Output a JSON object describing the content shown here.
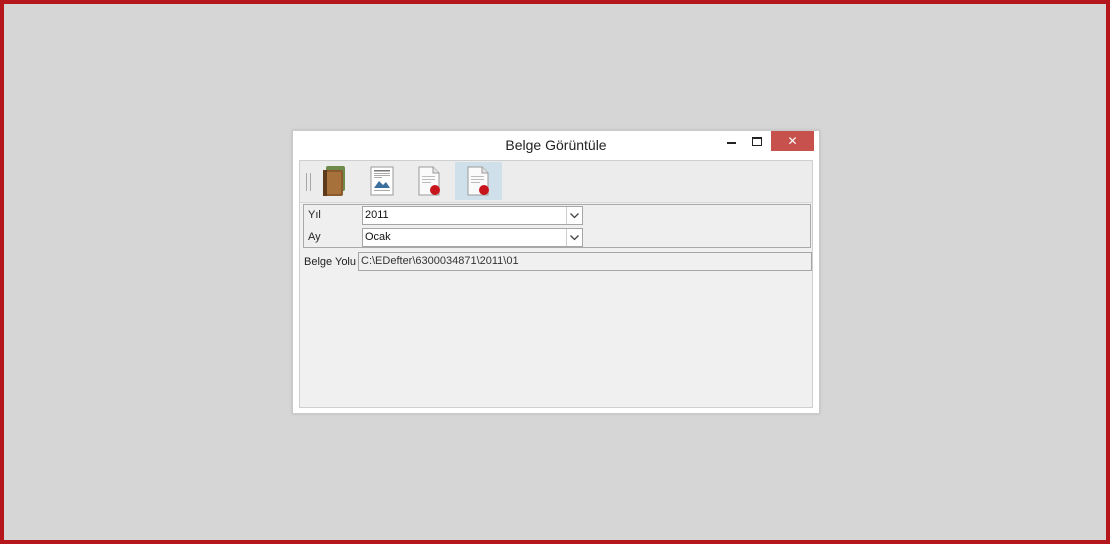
{
  "window": {
    "title": "Belge Görüntüle",
    "close_glyph": "✕"
  },
  "toolbar": {
    "items": [
      {
        "icon": "books-icon"
      },
      {
        "icon": "document-preview-icon"
      },
      {
        "icon": "document-seal-icon"
      },
      {
        "icon": "document-seal-active-icon",
        "active": true
      }
    ]
  },
  "form": {
    "year_label": "Yıl",
    "year_value": "2011",
    "month_label": "Ay",
    "month_value": "Ocak",
    "path_label": "Belge Yolu",
    "path_value": "C:\\EDefter\\6300034871\\2011\\01"
  },
  "colors": {
    "frame": "#b5161c",
    "close_button": "#c7514c",
    "active_tool": "#cfe0ea"
  }
}
